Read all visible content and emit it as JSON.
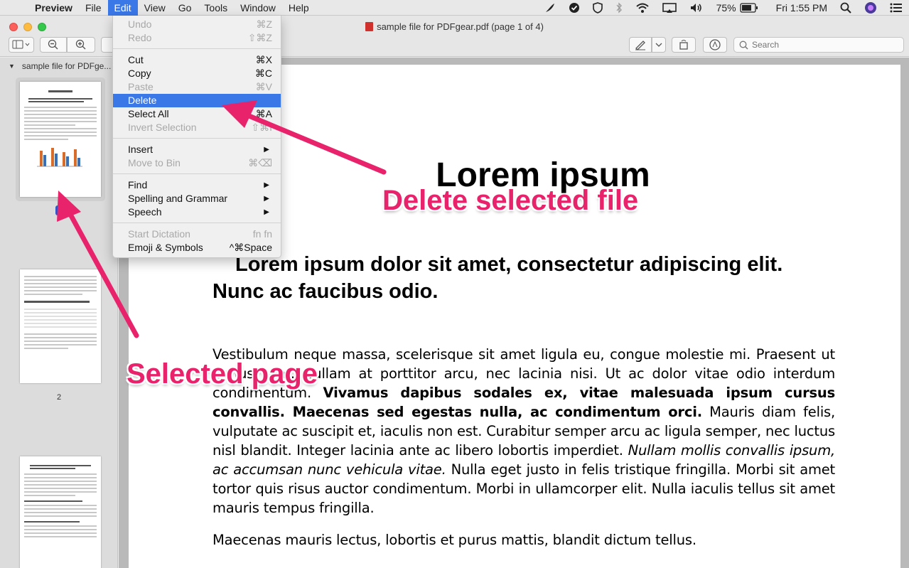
{
  "menubar": {
    "app": "Preview",
    "items": [
      "File",
      "Edit",
      "View",
      "Go",
      "Tools",
      "Window",
      "Help"
    ],
    "active_item": "Edit",
    "battery": "75%",
    "clock": "Fri 1:55 PM"
  },
  "window": {
    "title": "sample file for PDFgear.pdf (page 1 of 4)",
    "search_placeholder": "Search"
  },
  "sidebar": {
    "header": "sample file for PDFge...",
    "selected_page_badge": "1",
    "page_labels": [
      "2"
    ]
  },
  "edit_menu": {
    "items": [
      {
        "label": "Undo",
        "shortcut": "⌘Z",
        "enabled": false
      },
      {
        "label": "Redo",
        "shortcut": "⇧⌘Z",
        "enabled": false
      },
      {
        "label": "Cut",
        "shortcut": "⌘X",
        "enabled": true
      },
      {
        "label": "Copy",
        "shortcut": "⌘C",
        "enabled": true
      },
      {
        "label": "Paste",
        "shortcut": "⌘V",
        "enabled": false
      },
      {
        "label": "Delete",
        "shortcut": "",
        "enabled": true,
        "highlighted": true
      },
      {
        "label": "Select All",
        "shortcut": "⌘A",
        "enabled": true
      },
      {
        "label": "Invert Selection",
        "shortcut": "⇧⌘I",
        "enabled": false
      },
      {
        "label": "Insert",
        "shortcut": "",
        "enabled": true,
        "submenu": true
      },
      {
        "label": "Move to Bin",
        "shortcut": "⌘⌫",
        "enabled": false
      },
      {
        "label": "Find",
        "shortcut": "",
        "enabled": true,
        "submenu": true
      },
      {
        "label": "Spelling and Grammar",
        "shortcut": "",
        "enabled": true,
        "submenu": true
      },
      {
        "label": "Speech",
        "shortcut": "",
        "enabled": true,
        "submenu": true
      },
      {
        "label": "Start Dictation",
        "shortcut": "fn fn",
        "enabled": false
      },
      {
        "label": "Emoji & Symbols",
        "shortcut": "^⌘Space",
        "enabled": true
      }
    ]
  },
  "document": {
    "title": "Lorem ipsum",
    "subtitle": "Lorem ipsum dolor sit amet, consectetur adipiscing elit. Nunc ac faucibus odio.",
    "p1_a": "Vestibulum neque massa, scelerisque sit amet ligula eu, congue molestie mi. Praesent ut varius sem. Nullam at porttitor arcu, nec lacinia nisi. Ut ac dolor vitae odio interdum condimentum. ",
    "p1_bold": "Vivamus dapibus sodales ex, vitae malesuada ipsum cursus convallis. Maecenas sed egestas nulla, ac condimentum orci.",
    "p1_b": " Mauris diam felis, vulputate ac suscipit et, iaculis non est. Curabitur semper arcu ac ligula semper, nec luctus nisl blandit. Integer lacinia ante ac libero lobortis imperdiet. ",
    "p1_italic": "Nullam mollis convallis ipsum, ac accumsan nunc vehicula vitae.",
    "p1_c": " Nulla eget justo in felis tristique fringilla. Morbi sit amet tortor quis risus auctor condimentum. Morbi in ullamcorper elit. Nulla iaculis tellus sit amet mauris tempus fringilla.",
    "p2": "Maecenas mauris lectus, lobortis et purus mattis, blandit dictum tellus."
  },
  "annotations": {
    "delete_callout": "Delete selected file",
    "page_callout": "Selected page"
  },
  "colors": {
    "menu_highlight": "#3b78e7",
    "annotation": "#e8236b"
  }
}
